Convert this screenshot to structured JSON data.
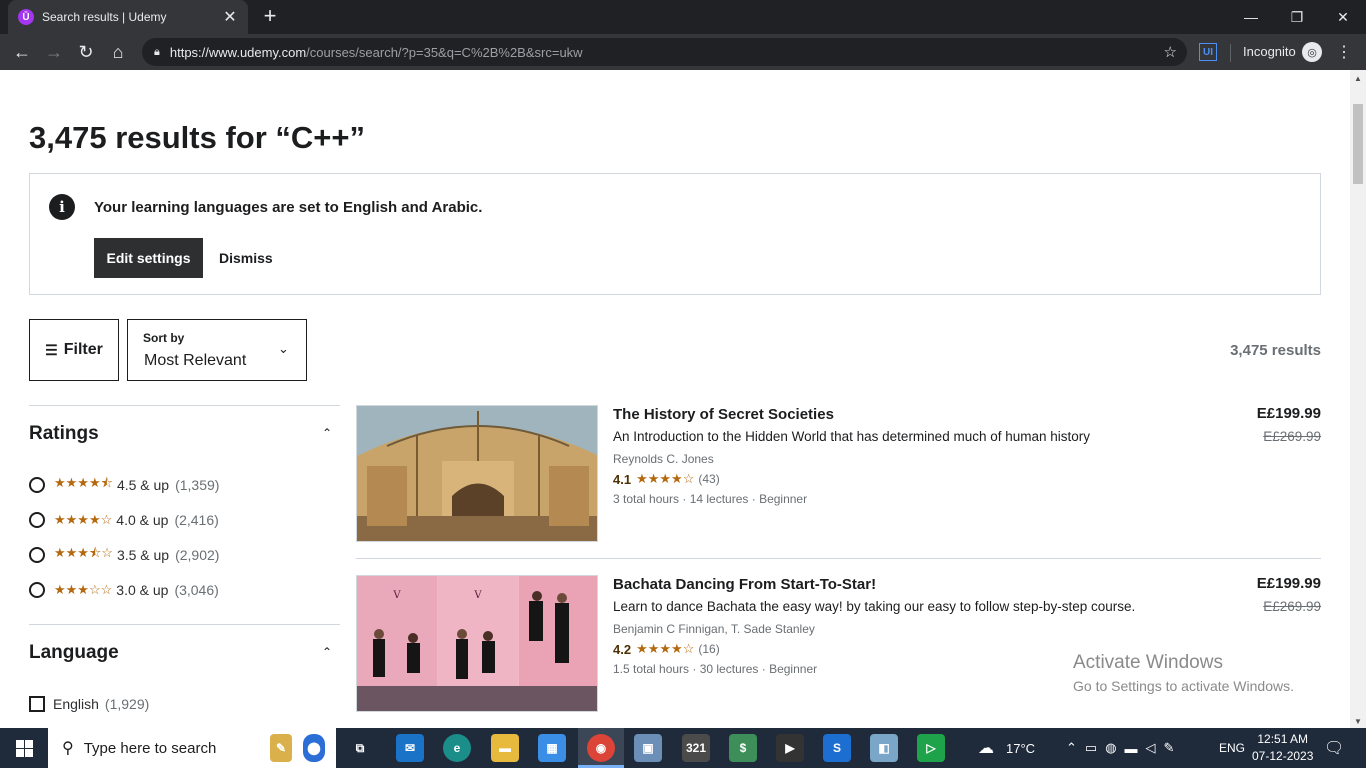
{
  "browser": {
    "tab_title": "Search results | Udemy",
    "tab_favicon": "Ū",
    "url_host": "https://www.udemy.com",
    "url_path": "/courses/search/?p=35&q=C%2B%2B&src=ukw",
    "incognito_label": "Incognito",
    "extension_label": "UI"
  },
  "page": {
    "heading": "3,475 results for “C++”",
    "notice": {
      "text": "Your learning languages are set to English and Arabic.",
      "edit_label": "Edit settings",
      "dismiss_label": "Dismiss"
    },
    "filter_label": "Filter",
    "sort": {
      "label": "Sort by",
      "value": "Most Relevant"
    },
    "total_results": "3,475 results"
  },
  "sidebar": {
    "ratings_heading": "Ratings",
    "ratings": [
      {
        "stars": "★★★★⯪",
        "label": "4.5 & up",
        "count": "(1,359)"
      },
      {
        "stars": "★★★★☆",
        "label": "4.0 & up",
        "count": "(2,416)"
      },
      {
        "stars": "★★★⯪☆",
        "label": "3.5 & up",
        "count": "(2,902)"
      },
      {
        "stars": "★★★☆☆",
        "label": "3.0 & up",
        "count": "(3,046)"
      }
    ],
    "language_heading": "Language",
    "languages": [
      {
        "label": "English",
        "count": "(1,929)"
      }
    ]
  },
  "courses": [
    {
      "title": "The History of Secret Societies",
      "description": "An Introduction to the Hidden World that has determined much of human history",
      "author": "Reynolds C. Jones",
      "rating": "4.1",
      "stars": "★★★★☆",
      "rating_count": "(43)",
      "meta": "3 total hours · 14 lectures · Beginner",
      "price": "E£199.99",
      "old_price": "E£269.99"
    },
    {
      "title": "Bachata Dancing From Start-To-Star!",
      "description": "Learn to dance Bachata the easy way! by taking our easy to follow step-by-step course.",
      "author": "Benjamin C Finnigan, T. Sade Stanley",
      "rating": "4.2",
      "stars": "★★★★☆",
      "rating_count": "(16)",
      "meta": "1.5 total hours · 30 lectures · Beginner",
      "price": "E£199.99",
      "old_price": "E£269.99"
    }
  ],
  "watermark": {
    "title": "Activate Windows",
    "subtitle": "Go to Settings to activate Windows."
  },
  "taskbar": {
    "search_placeholder": "Type here to search",
    "weather": "17°C",
    "lang": "ENG",
    "time": "12:51 AM",
    "date": "07-12-2023"
  },
  "colors": {
    "star": "#b4690e",
    "dark_button": "#2d2f31",
    "udemy_purple": "#a435f0"
  }
}
